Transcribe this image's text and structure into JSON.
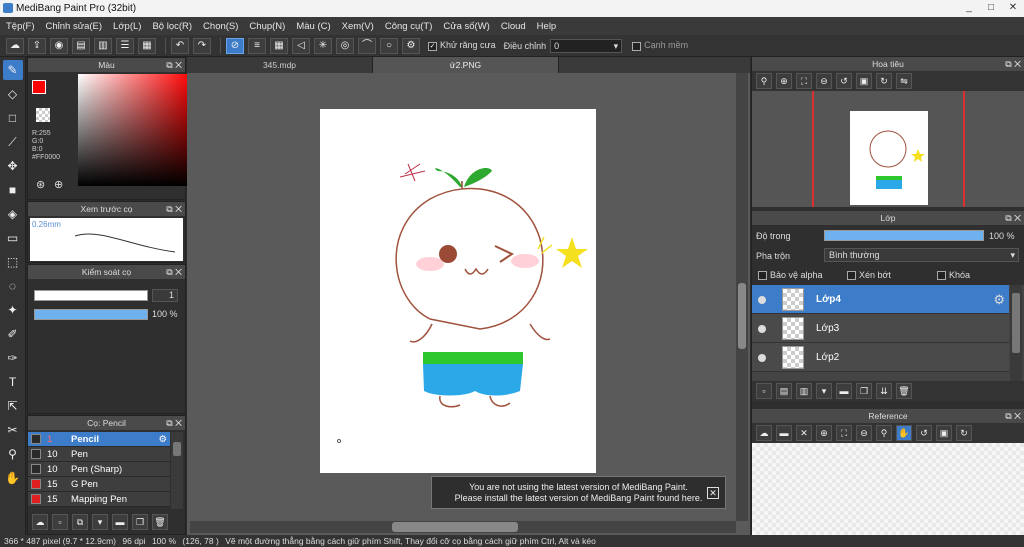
{
  "app": {
    "title": "MediBang Paint Pro (32bit)"
  },
  "window_buttons": [
    "_",
    "□",
    "✕"
  ],
  "menu": [
    "Tệp(F)",
    "Chỉnh sửa(E)",
    "Lớp(L)",
    "Bộ lọc(R)",
    "Chọn(S)",
    "Chụp(N)",
    "Màu (C)",
    "Xem(V)",
    "Công cụ(T)",
    "Cửa số(W)",
    "Cloud",
    "Help"
  ],
  "toolbar": {
    "antialias_label": "Khử răng cưa",
    "adjust_label": "Điều chỉnh",
    "adjust_value": "0",
    "edge_label": "Cạnh mềm"
  },
  "color_panel": {
    "title": "Màu",
    "r": "R:255",
    "g": "G:0",
    "b": "B:0",
    "hex": "#FF0000"
  },
  "brush_preview": {
    "title": "Xem trước cọ",
    "size": "0.26mm"
  },
  "brush_control": {
    "title": "Kiểm soát cọ",
    "size_value": "1",
    "opacity_value": "100 %"
  },
  "brush_list": {
    "title": "Cọ: Pencil",
    "items": [
      {
        "size": "1",
        "name": "Pencil",
        "color": "#2a2a2a"
      },
      {
        "size": "10",
        "name": "Pen",
        "color": "#2a2a2a"
      },
      {
        "size": "10",
        "name": "Pen (Sharp)",
        "color": "#2a2a2a"
      },
      {
        "size": "15",
        "name": "G Pen",
        "color": "#e02020"
      },
      {
        "size": "15",
        "name": "Mapping Pen",
        "color": "#e02020"
      }
    ]
  },
  "tabs": [
    {
      "label": "345.mdp",
      "active": false
    },
    {
      "label": "ứ2.PNG",
      "active": true
    }
  ],
  "notice": {
    "line1": "You are not using the latest version of MediBang Paint.",
    "line2": "Please install the latest version of MediBang Paint found here."
  },
  "navigator": {
    "title": "Hoa tiêu"
  },
  "layers_panel": {
    "title": "Lớp",
    "opacity_label": "Độ trong",
    "opacity_value": "100 %",
    "opacity": 1.0,
    "blend_label": "Pha trộn",
    "blend_value": "Bình thường",
    "protect_alpha": "Bảo vệ alpha",
    "clip": "Xén bớt",
    "lock": "Khóa",
    "layers": [
      {
        "name": "Lớp4",
        "selected": true
      },
      {
        "name": "Lớp3",
        "selected": false
      },
      {
        "name": "Lớp2",
        "selected": false
      }
    ]
  },
  "reference": {
    "title": "Reference"
  },
  "status": {
    "size": "366 * 487 pixel",
    "size_cm": "(9.7 * 12.9cm)",
    "dpi": "96 dpi",
    "zoom": "100 %",
    "coords": "(126, 78 )",
    "hint": "Vẽ một đường thẳng bằng cách giữ phím Shift, Thay đổi cỡ cọ bằng cách giữ phím Ctrl, Alt và kéo"
  },
  "colors": {
    "accent": "#3d7cc9",
    "primary": "#ff0000",
    "secondary": "#00aa00"
  }
}
